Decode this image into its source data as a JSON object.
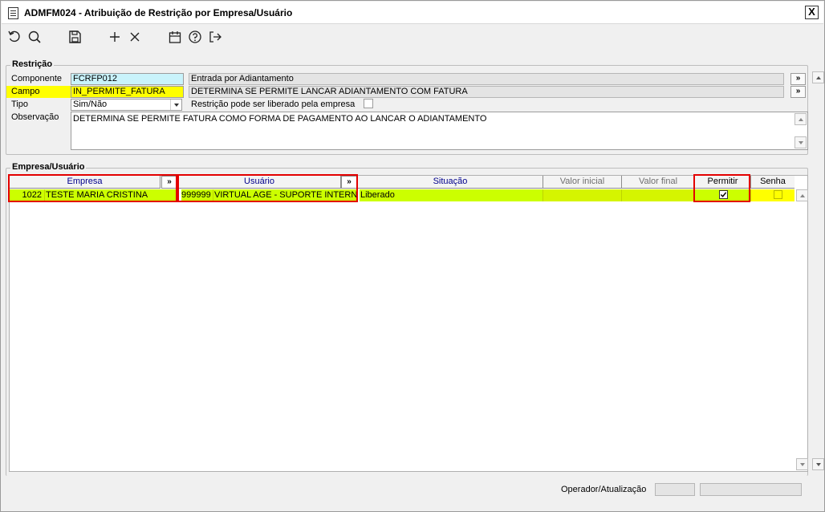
{
  "window": {
    "title": "ADMFM024 - Atribuição de Restrição por Empresa/Usuário",
    "close_label": "X"
  },
  "toolbar": {
    "icons": [
      "undo-icon",
      "search-icon",
      "save-icon",
      "add-icon",
      "delete-icon",
      "calendar-icon",
      "help-icon",
      "exit-icon"
    ]
  },
  "restricao": {
    "legend": "Restrição",
    "componente_label": "Componente",
    "componente_value": "FCRFP012",
    "componente_desc": "Entrada por Adiantamento",
    "campo_label": "Campo",
    "campo_value": "IN_PERMITE_FATURA",
    "campo_desc": "DETERMINA SE PERMITE LANCAR ADIANTAMENTO COM FATURA",
    "tipo_label": "Tipo",
    "tipo_value": "Sim/Não",
    "liberado_label": "Restrição pode ser liberado pela empresa",
    "observacao_label": "Observação",
    "observacao_value": "DETERMINA SE PERMITE FATURA COMO FORMA DE PAGAMENTO AO LANCAR O ADIANTAMENTO",
    "go_label": "»"
  },
  "empresa_usuario": {
    "legend": "Empresa/Usuário",
    "columns": {
      "empresa": "Empresa",
      "usuario": "Usuário",
      "situacao": "Situação",
      "valor_inicial": "Valor inicial",
      "valor_final": "Valor final",
      "permitir": "Permitir",
      "senha": "Senha"
    },
    "go_label": "»",
    "rows": [
      {
        "empresa_cod": "1022",
        "empresa_nome": "TESTE MARIA CRISTINA",
        "usuario_cod": "999999",
        "usuario_nome": "VIRTUAL AGE - SUPORTE INTERNO CLIENTES",
        "situacao": "Liberado",
        "valor_inicial": "",
        "valor_final": "",
        "permitir": true,
        "senha": false
      }
    ]
  },
  "footer": {
    "operador_label": "Operador/Atualização"
  },
  "colors": {
    "row_highlight": "#ccff00",
    "campo_highlight": "#ffff00",
    "componente_highlight": "#c9f3fb",
    "annotation_red": "#e30000"
  }
}
